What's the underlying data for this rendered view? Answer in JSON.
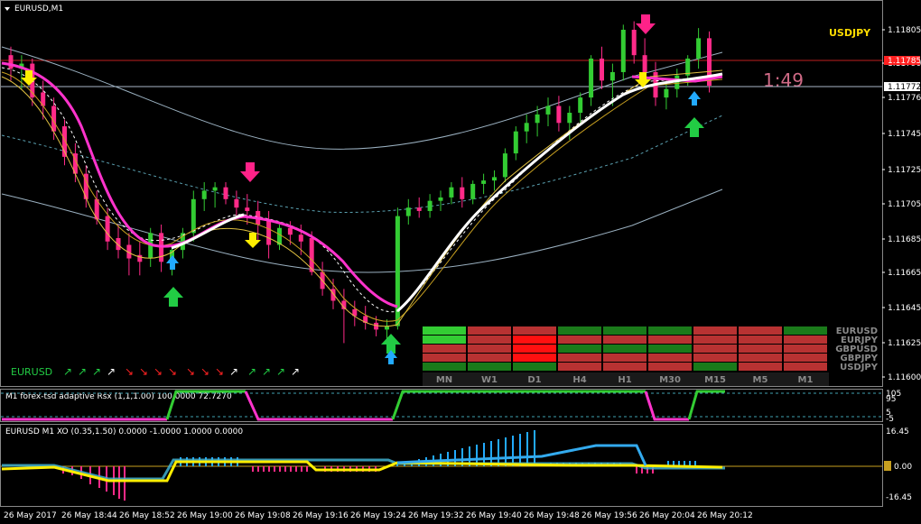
{
  "main": {
    "title": "EURUSD,M1",
    "pair_label": "USDJPY",
    "timer": "1:49",
    "prices": [
      "1.11805",
      "1.11790",
      "1.11776",
      "1.11745",
      "1.11725",
      "1.11705",
      "1.11685",
      "1.11665",
      "1.11645",
      "1.11625",
      "1.11600"
    ],
    "price_tags": [
      "1.11785",
      "1.11772"
    ],
    "bottom_left_label": "EURUSD",
    "arrow_groups": [
      {
        "colors": [
          "#22cc44",
          "#22cc44",
          "#22cc44",
          "#ffffff"
        ]
      },
      {
        "colors": [
          "#ff2222",
          "#ff2222",
          "#ff2222",
          "#ff2222"
        ]
      },
      {
        "colors": [
          "#ff2222",
          "#ff2222",
          "#ff2222",
          "#ffffff"
        ]
      },
      {
        "colors": [
          "#22cc44",
          "#22cc44",
          "#22cc44",
          "#ffffff"
        ]
      }
    ]
  },
  "currency_grid": {
    "rows": [
      "EURUSD",
      "EURJPY",
      "GBPUSD",
      "GBPJPY",
      "USDJPY"
    ],
    "columns": [
      "MN",
      "W1",
      "D1",
      "H4",
      "H1",
      "M30",
      "M15",
      "M5",
      "M1"
    ],
    "cells": [
      [
        "g2",
        "r1",
        "r1",
        "g1",
        "g1",
        "g1",
        "r1",
        "r1",
        "g1"
      ],
      [
        "g2",
        "r1",
        "r2",
        "r1",
        "r1",
        "r1",
        "r1",
        "r1",
        "r1"
      ],
      [
        "r1",
        "r1",
        "r2",
        "g1",
        "g1",
        "g1",
        "r1",
        "r1",
        "r1"
      ],
      [
        "r1",
        "r1",
        "r2",
        "r1",
        "r1",
        "r1",
        "r1",
        "r1",
        "r1"
      ],
      [
        "g1",
        "g1",
        "g1",
        "r1",
        "r1",
        "r1",
        "g1",
        "r1",
        "r1"
      ]
    ],
    "colors": {
      "g1": "#1a7a1a",
      "g2": "#33cc33",
      "r1": "#b83232",
      "r2": "#ff1010"
    }
  },
  "indicator1": {
    "title": "M1 forex-tsd adaptive Rsx (1,1,1.00) 100.0000 72.7270",
    "right_labels": [
      "105",
      "95",
      "5",
      "-5"
    ]
  },
  "indicator2": {
    "title": "EURUSD M1 XO (0.35,1.50) 0.0000 -1.0000 1.0000 0.0000",
    "right_labels": [
      "16.45",
      "0.00",
      "-16.45"
    ]
  },
  "time_axis": [
    "26 May 2017",
    "26 May 18:44",
    "26 May 18:52",
    "26 May 19:00",
    "26 May 19:08",
    "26 May 19:16",
    "26 May 19:24",
    "26 May 19:32",
    "26 May 19:40",
    "26 May 19:48",
    "26 May 19:56",
    "26 May 20:04",
    "26 May 20:12"
  ],
  "candles": [
    [
      1.1179,
      1.11795,
      1.11775,
      1.11782
    ],
    [
      1.11782,
      1.1179,
      1.1177,
      1.11785
    ],
    [
      1.11785,
      1.11788,
      1.1176,
      1.11765
    ],
    [
      1.11768,
      1.11775,
      1.11752,
      1.1176
    ],
    [
      1.1176,
      1.11765,
      1.1174,
      1.11745
    ],
    [
      1.11748,
      1.11752,
      1.11725,
      1.1173
    ],
    [
      1.11732,
      1.11738,
      1.11715,
      1.1172
    ],
    [
      1.1172,
      1.11725,
      1.117,
      1.11705
    ],
    [
      1.11705,
      1.1171,
      1.1169,
      1.11693
    ],
    [
      1.11695,
      1.117,
      1.11675,
      1.1168
    ],
    [
      1.11682,
      1.1169,
      1.1167,
      1.11675
    ],
    [
      1.11678,
      1.11685,
      1.1166,
      1.1167
    ],
    [
      1.11672,
      1.1168,
      1.1166,
      1.11668
    ],
    [
      1.1167,
      1.11688,
      1.11665,
      1.11685
    ],
    [
      1.11685,
      1.1169,
      1.11662,
      1.11668
    ],
    [
      1.11668,
      1.11678,
      1.1166,
      1.11675
    ],
    [
      1.11675,
      1.11688,
      1.1167,
      1.11685
    ],
    [
      1.11685,
      1.1171,
      1.1168,
      1.11705
    ],
    [
      1.11705,
      1.11715,
      1.11698,
      1.1171
    ],
    [
      1.1171,
      1.11715,
      1.117,
      1.11712
    ],
    [
      1.11712,
      1.11715,
      1.11702,
      1.11705
    ],
    [
      1.11705,
      1.1171,
      1.11695,
      1.117
    ],
    [
      1.117,
      1.11708,
      1.1169,
      1.11698
    ],
    [
      1.11698,
      1.11704,
      1.1168,
      1.1169
    ],
    [
      1.11692,
      1.11698,
      1.1167,
      1.11678
    ],
    [
      1.11678,
      1.1169,
      1.11675,
      1.11688
    ],
    [
      1.11688,
      1.11692,
      1.11678,
      1.11684
    ],
    [
      1.11684,
      1.1169,
      1.11672,
      1.1168
    ],
    [
      1.11682,
      1.11686,
      1.1166,
      1.11662
    ],
    [
      1.11662,
      1.11668,
      1.11648,
      1.11652
    ],
    [
      1.11652,
      1.11658,
      1.1164,
      1.11645
    ],
    [
      1.11645,
      1.11652,
      1.1162,
      1.1164
    ],
    [
      1.1164,
      1.11645,
      1.1163,
      1.11636
    ],
    [
      1.11636,
      1.11642,
      1.11628,
      1.11632
    ],
    [
      1.11632,
      1.11636,
      1.11624,
      1.11628
    ],
    [
      1.11628,
      1.11634,
      1.11622,
      1.1163
    ],
    [
      1.1163,
      1.117,
      1.11628,
      1.11695
    ],
    [
      1.11695,
      1.11705,
      1.1169,
      1.117
    ],
    [
      1.117,
      1.11706,
      1.11694,
      1.11698
    ],
    [
      1.11698,
      1.11708,
      1.11694,
      1.11704
    ],
    [
      1.11704,
      1.1171,
      1.11698,
      1.11706
    ],
    [
      1.11706,
      1.11715,
      1.11702,
      1.11712
    ],
    [
      1.11712,
      1.11718,
      1.117,
      1.11705
    ],
    [
      1.11705,
      1.11716,
      1.11702,
      1.11714
    ],
    [
      1.11714,
      1.1172,
      1.11708,
      1.11716
    ],
    [
      1.11716,
      1.11722,
      1.1171,
      1.11718
    ],
    [
      1.11718,
      1.11735,
      1.11715,
      1.11732
    ],
    [
      1.11732,
      1.11748,
      1.11728,
      1.11745
    ],
    [
      1.11745,
      1.11755,
      1.11738,
      1.1175
    ],
    [
      1.1175,
      1.1176,
      1.11742,
      1.11755
    ],
    [
      1.11755,
      1.11765,
      1.11748,
      1.1176
    ],
    [
      1.1176,
      1.11766,
      1.11745,
      1.1175
    ],
    [
      1.1175,
      1.1176,
      1.1174,
      1.11756
    ],
    [
      1.11756,
      1.11768,
      1.1175,
      1.11765
    ],
    [
      1.11765,
      1.1179,
      1.1176,
      1.11788
    ],
    [
      1.11788,
      1.11795,
      1.1177,
      1.11775
    ],
    [
      1.11775,
      1.11785,
      1.1176,
      1.1178
    ],
    [
      1.1178,
      1.11808,
      1.11775,
      1.11805
    ],
    [
      1.11805,
      1.1181,
      1.11785,
      1.1179
    ],
    [
      1.1179,
      1.118,
      1.11775,
      1.1178
    ],
    [
      1.1178,
      1.11786,
      1.1176,
      1.11765
    ],
    [
      1.11765,
      1.11775,
      1.11758,
      1.1177
    ],
    [
      1.1177,
      1.11782,
      1.11765,
      1.11778
    ],
    [
      1.11778,
      1.1179,
      1.11772,
      1.11788
    ],
    [
      1.11788,
      1.11806,
      1.11782,
      1.118
    ],
    [
      1.118,
      1.11804,
      1.11768,
      1.11772
    ]
  ]
}
